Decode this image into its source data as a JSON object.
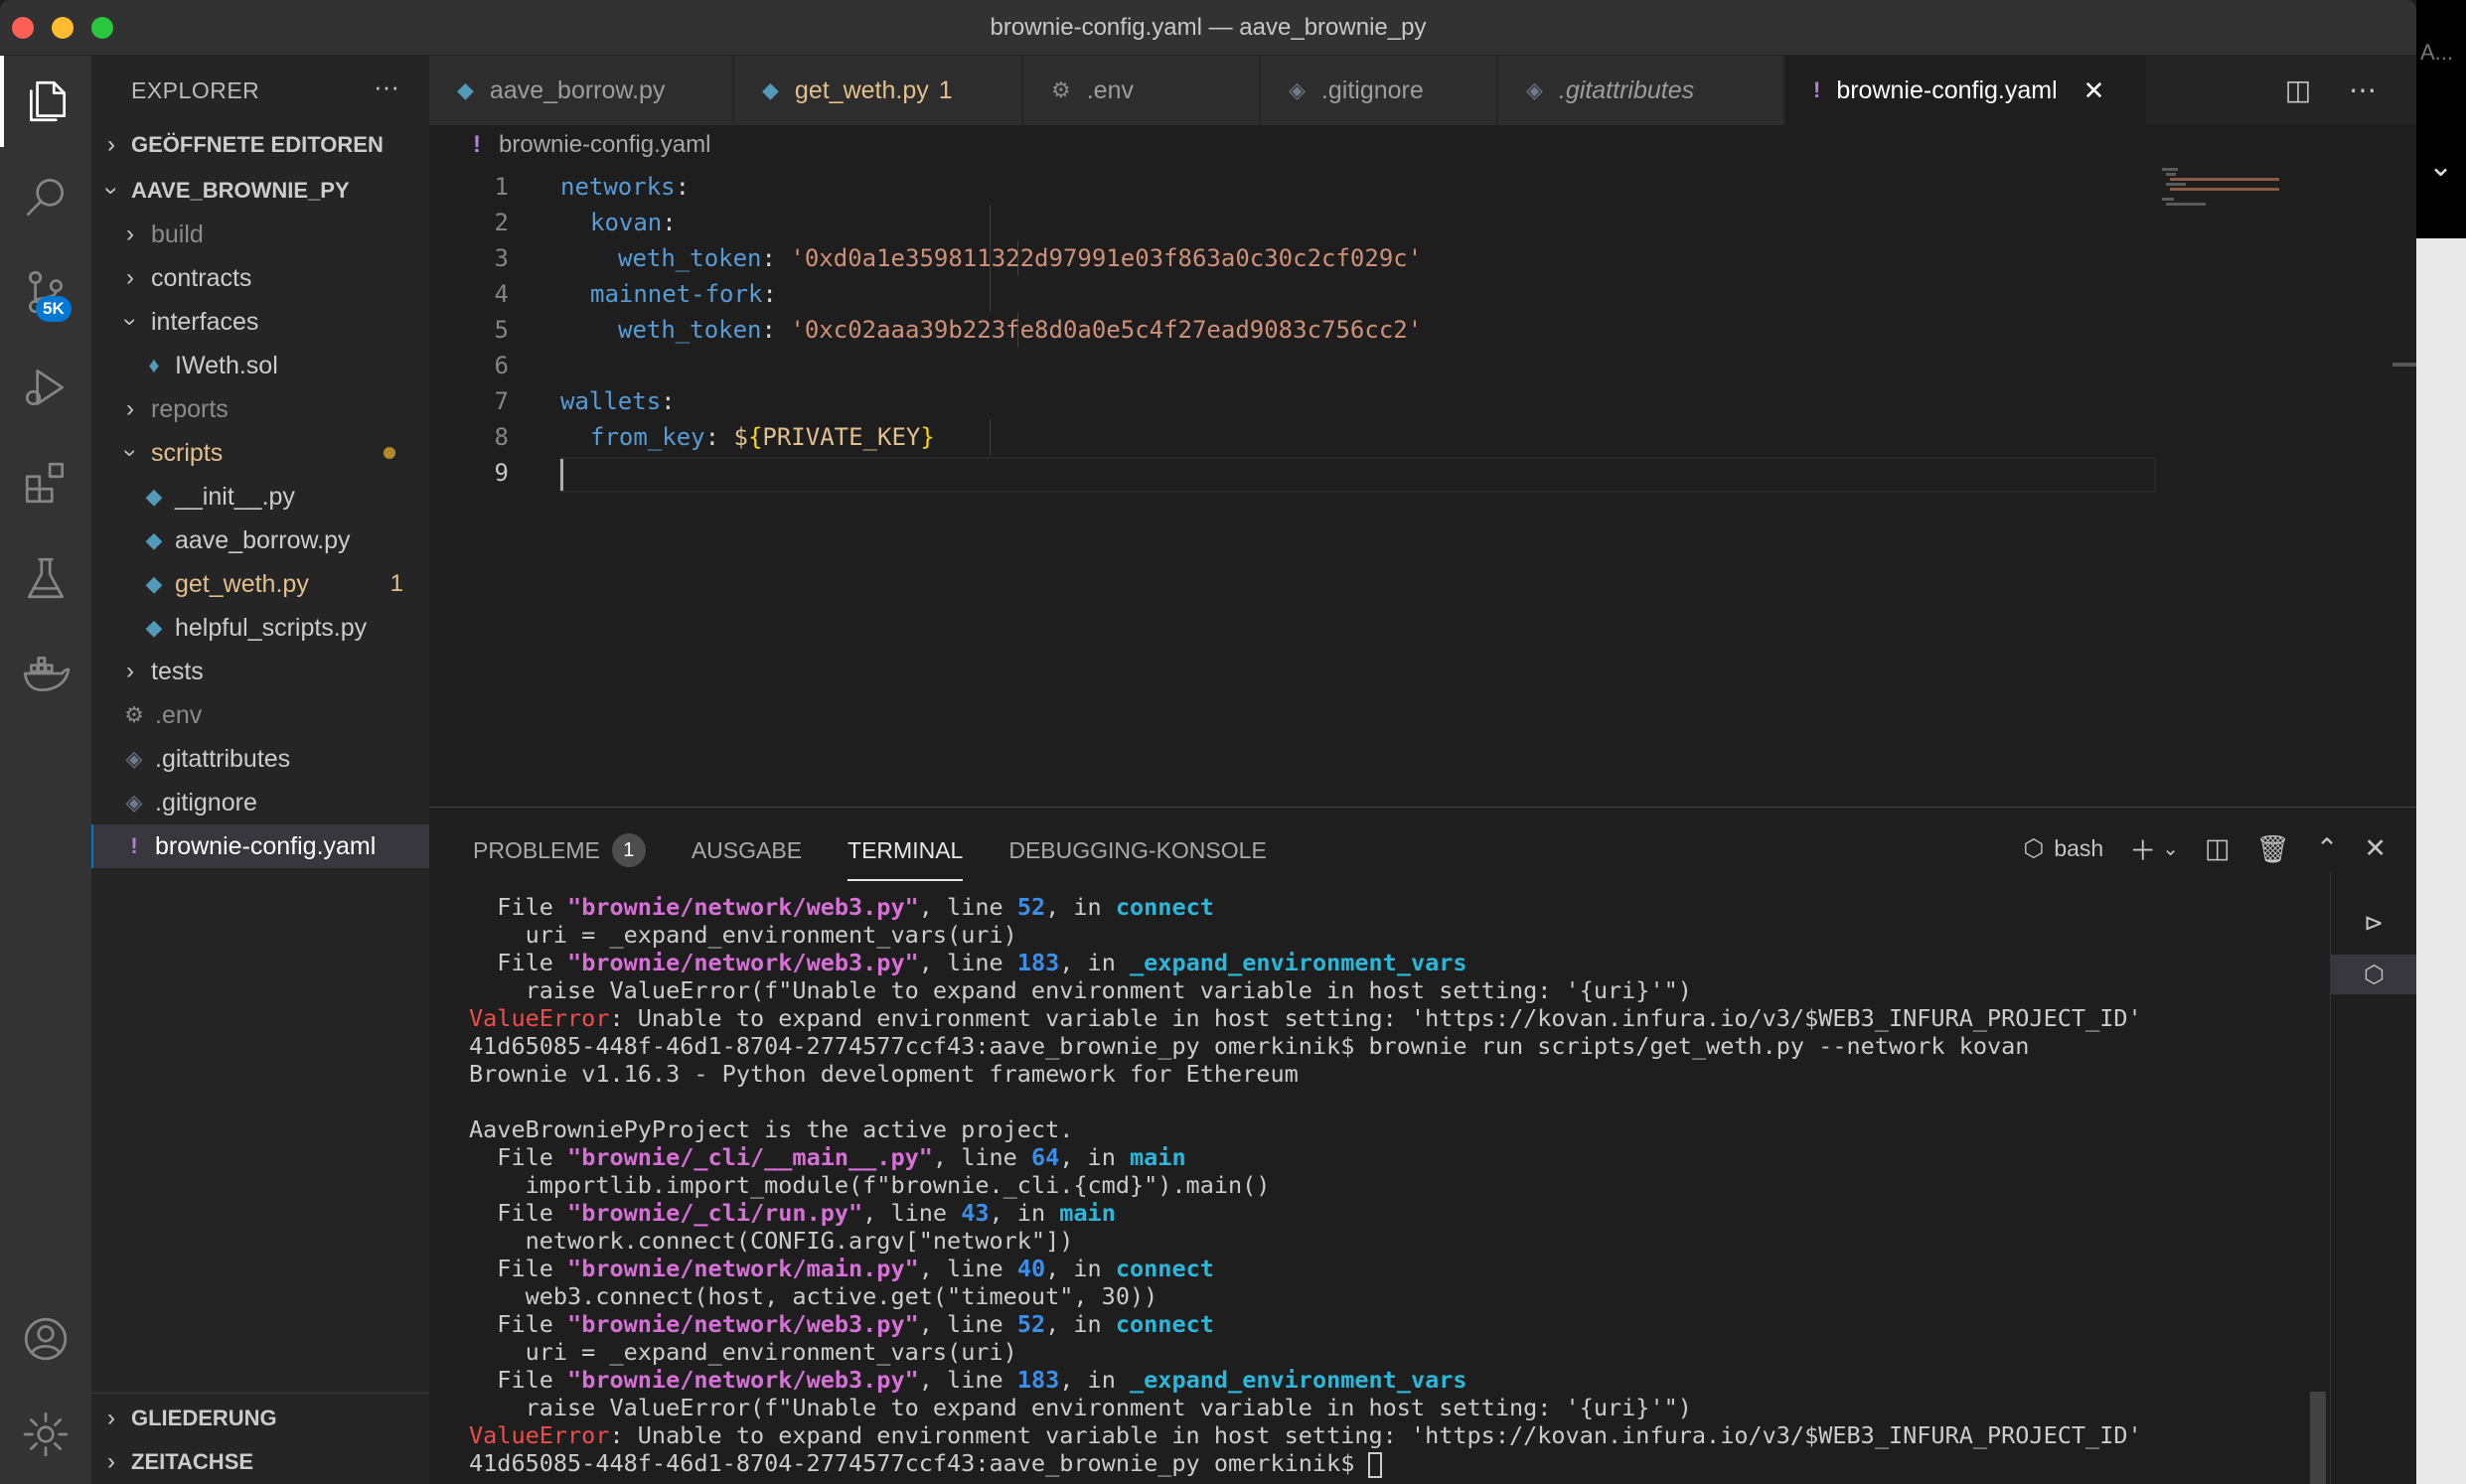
{
  "window": {
    "title": "brownie-config.yaml — aave_brownie_py"
  },
  "right_strip": {
    "caption": "A..."
  },
  "activity_bar": {
    "scm_badge": "5K"
  },
  "sidebar": {
    "header": "EXPLORER",
    "more": "···",
    "open_editors": "GEÖFFNETE EDITOREN",
    "project": "AAVE_BROWNIE_PY",
    "outline": "GLIEDERUNG",
    "timeline": "ZEITACHSE",
    "items": [
      {
        "label": "build"
      },
      {
        "label": "contracts"
      },
      {
        "label": "interfaces"
      },
      {
        "label": "IWeth.sol"
      },
      {
        "label": "reports"
      },
      {
        "label": "scripts"
      },
      {
        "label": "__init__.py"
      },
      {
        "label": "aave_borrow.py"
      },
      {
        "label": "get_weth.py",
        "count": "1"
      },
      {
        "label": "helpful_scripts.py"
      },
      {
        "label": "tests"
      },
      {
        "label": ".env"
      },
      {
        "label": ".gitattributes"
      },
      {
        "label": ".gitignore"
      },
      {
        "label": "brownie-config.yaml"
      }
    ]
  },
  "tabs": [
    {
      "label": "aave_borrow.py"
    },
    {
      "label": "get_weth.py",
      "count": "1"
    },
    {
      "label": ".env"
    },
    {
      "label": ".gitignore"
    },
    {
      "label": ".gitattributes"
    },
    {
      "label": "brownie-config.yaml"
    }
  ],
  "breadcrumb": "brownie-config.yaml",
  "editor": {
    "line_numbers": [
      "1",
      "2",
      "3",
      "4",
      "5",
      "6",
      "7",
      "8",
      "9"
    ],
    "l1_key": "networks",
    "l2_key": "kovan",
    "l3_key": "weth_token",
    "l3_val": "'0xd0a1e359811322d97991e03f863a0c30c2cf029c'",
    "l4_key": "mainnet-fork",
    "l5_key": "weth_token",
    "l5_val": "'0xc02aaa39b223fe8d0a0e5c4f27ead9083c756cc2'",
    "l7_key": "wallets",
    "l8_key": "from_key",
    "l8_dollar": "$",
    "l8_open": "{",
    "l8_var": "PRIVATE_KEY",
    "l8_close": "}",
    "colon": ":"
  },
  "panel": {
    "tabs": [
      "PROBLEME",
      "AUSGABE",
      "TERMINAL",
      "DEBUGGING-KONSOLE"
    ],
    "problems_count": "1",
    "shell": "bash"
  },
  "terminal": {
    "file": "File ",
    "comma_line": ", line ",
    "comma_in": ", in ",
    "web3_path": "\"brownie/network/web3.py\"",
    "main_path": "\"brownie/network/main.py\"",
    "cli_main_path": "\"brownie/_cli/__main__.py\"",
    "cli_run_path": "\"brownie/_cli/run.py\"",
    "n52": "52",
    "n183": "183",
    "n64": "64",
    "n43": "43",
    "n40": "40",
    "fn_connect": "connect",
    "fn_expand": "_expand_environment_vars",
    "fn_main": "main",
    "uri_line": "uri = _expand_environment_vars(uri)",
    "raise_line": "raise ValueError(f\"Unable to expand environment variable in host setting: '{uri}'\")",
    "value_error": "ValueError",
    "error_msg": ": Unable to expand environment variable in host setting: 'https://kovan.infura.io/v3/$WEB3_INFURA_PROJECT_ID'",
    "prompt_cmd": "41d65085-448f-46d1-8704-2774577ccf43:aave_brownie_py omerkinik$ brownie run scripts/get_weth.py --network kovan",
    "brownie_version": "Brownie v1.16.3 - Python development framework for Ethereum",
    "active_project": "AaveBrowniePyProject is the active project.",
    "importlib_line": "importlib.import_module(f\"brownie._cli.{cmd}\").main()",
    "network_connect": "network.connect(CONFIG.argv[\"network\"])",
    "web3_connect": "web3.connect(host, active.get(\"timeout\", 30))",
    "final_prompt": "41d65085-448f-46d1-8704-2774577ccf43:aave_brownie_py omerkinik$ "
  }
}
